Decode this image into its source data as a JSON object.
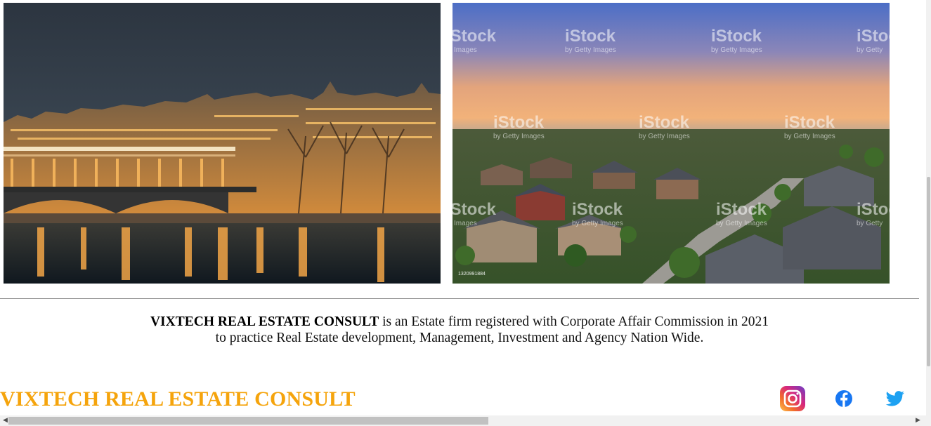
{
  "gallery": {
    "left_image_alt": "Paris riverside at dusk",
    "right_image_alt": "Suburban neighbourhood at sunset",
    "watermark_text": "iStock",
    "watermark_sub": "by Getty Images",
    "stock_id": "1320991884"
  },
  "about": {
    "company": "VIXTECH REAL ESTATE CONSULT",
    "line1_rest": " is an Estate firm registered with Corporate Affair Commission in 2021",
    "line2": "to practice Real Estate development, Management, Investment and Agency Nation Wide."
  },
  "footer": {
    "brand": "VIXTECH REAL ESTATE CONSULT",
    "social": [
      {
        "name": "instagram-icon"
      },
      {
        "name": "facebook-icon"
      },
      {
        "name": "twitter-icon"
      }
    ]
  },
  "colors": {
    "brand_orange": "#f5a40c",
    "facebook_blue": "#1877f2",
    "twitter_blue": "#1da1f2"
  }
}
